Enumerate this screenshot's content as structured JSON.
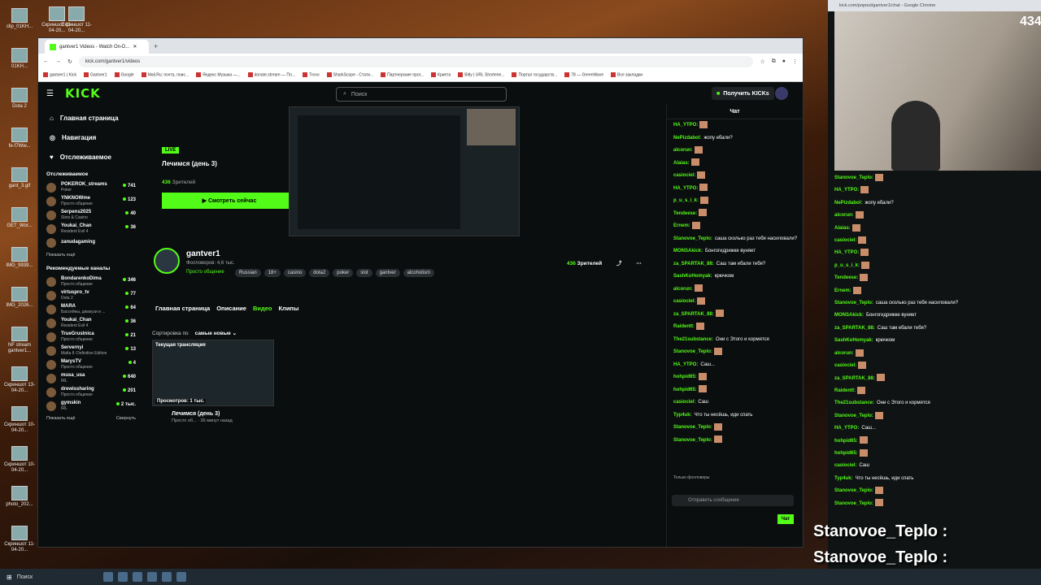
{
  "desktop": {
    "icons": [
      "clip_01KH...",
      "01KH...",
      "Dota 2",
      "fe-f7Ww...",
      "gant_3.gif",
      "GET_Wor...",
      "IMG_9939...",
      "IMG_2026...",
      "NF stream gantver1...",
      "Скриншот 13-04-20...",
      "Скриншот 10-04-20...",
      "Скриншот 10-04-20...",
      "photo_202...",
      "Скриншот 11-04-20..."
    ],
    "top_icons": [
      "Скриншот 11-04-20...",
      "Скриншот 11-04-20..."
    ]
  },
  "browser": {
    "tab_title": "gantver1 Videos - Watch On-D...",
    "url": "kick.com/gantver1/videos",
    "bookmarks": [
      "gantver1 | Kick",
      "Gantver1",
      "Google",
      "Mail.Ru: почта, поис...",
      "Яндекс Музыка —...",
      "donate.stream — Пл...",
      "Trovo",
      "SharkScope - Стати...",
      "Партнерские прог...",
      "Крипта",
      "Bitly | URL Shortene...",
      "Портал государств...",
      "78 — GreenWave",
      "Все закладки"
    ]
  },
  "kick": {
    "logo": "KICK",
    "search_placeholder": "Поиск",
    "get_kicks": "Получить KICKs",
    "nav": [
      "Главная страница",
      "Навигация",
      "Отслеживаемое"
    ],
    "followed_title": "Отслеживаемое",
    "followed": [
      {
        "name": "POKEROK_streams",
        "cat": "Poker",
        "viewers": "741"
      },
      {
        "name": "YNKNOWme",
        "cat": "Просто общение",
        "viewers": "123"
      },
      {
        "name": "Serpens2025",
        "cat": "Slots & Casino",
        "viewers": "40"
      },
      {
        "name": "Youkai_Chan",
        "cat": "Resident Evil 4",
        "viewers": "36"
      },
      {
        "name": "zanudagaming",
        "cat": "",
        "viewers": ""
      }
    ],
    "show_more": "Показать ещё",
    "recommended_title": "Рекомендуемые каналы",
    "recommended": [
      {
        "name": "BondarenkoDima",
        "cat": "Просто общение",
        "viewers": "346"
      },
      {
        "name": "virtuspro_tv",
        "cat": "Dota 2",
        "viewers": "77"
      },
      {
        "name": "MARA",
        "cat": "Бассейны, джакузи и ...",
        "viewers": "64"
      },
      {
        "name": "Youkai_Chan",
        "cat": "Resident Evil 4",
        "viewers": "36"
      },
      {
        "name": "TrueGrustnica",
        "cat": "Просто общение",
        "viewers": "21"
      },
      {
        "name": "Servernyi",
        "cat": "Mafia II: Definitive Edition",
        "viewers": "13"
      },
      {
        "name": "MarysTV",
        "cat": "Просто общение",
        "viewers": "4"
      },
      {
        "name": "musa_usa",
        "cat": "IRL",
        "viewers": "640"
      },
      {
        "name": "drewissharing",
        "cat": "Просто общение",
        "viewers": "201"
      },
      {
        "name": "gymskin",
        "cat": "IRL",
        "viewers": "2 тыс."
      }
    ],
    "show_more2": "Показать ещё",
    "collapse": "Свернуть",
    "hero": {
      "live": "LIVE",
      "title": "Лечимся (день 3)",
      "viewers": "436",
      "viewers_label": "Зрителей",
      "watch": "Смотреть сейчас"
    },
    "channel": {
      "name": "gantver1",
      "followers": "Фолловеров: 4,6 тыс.",
      "category": "Просто общение",
      "tags": [
        "Russian",
        "18+",
        "casino",
        "dota2",
        "poker",
        "slot",
        "gantver",
        "alcoholism"
      ],
      "viewers": "436",
      "viewers_label": "Зрителей"
    },
    "tabs": [
      "Главная страница",
      "Описание",
      "Видео",
      "Клипы"
    ],
    "sort_label": "Сортировка по",
    "sort_value": "самые новые",
    "video": {
      "badge": "Текущая трансляция",
      "views": "Просмотров: 1 тыс.",
      "title": "Лечимся (день 3)",
      "meta": "Просто об... · 36 минут назад"
    },
    "chat_title": "Чат",
    "chat": [
      {
        "u": "HA_YTPO:",
        "t": ""
      },
      {
        "u": "NePizdabol:",
        "t": "жопу ебали?"
      },
      {
        "u": "alcorun:",
        "t": ""
      },
      {
        "u": "Alaias:",
        "t": ""
      },
      {
        "u": "casiociel:",
        "t": ""
      },
      {
        "u": "HA_YTPO:",
        "t": ""
      },
      {
        "u": "p_u_s_i_k:",
        "t": ""
      },
      {
        "u": "Tendeese:",
        "t": ""
      },
      {
        "u": "Ernem:",
        "t": ""
      },
      {
        "u": "Stanovoe_Teplo:",
        "t": "саша сколько раз тебя насиловали?"
      },
      {
        "u": "MONSAkick:",
        "t": "Бонгогидрижке вуняет"
      },
      {
        "u": "za_SPARTAK_88:",
        "t": "Саш там ебали тебя?"
      },
      {
        "u": "SashKoHomyak:",
        "t": "крючком"
      },
      {
        "u": "alcorun:",
        "t": ""
      },
      {
        "u": "casiociel:",
        "t": ""
      },
      {
        "u": "za_SPARTAK_88:",
        "t": ""
      },
      {
        "u": "Raidentt:",
        "t": ""
      },
      {
        "u": "The21substance:",
        "t": "Они с Этого и кормятся"
      },
      {
        "u": "Stanovoe_Teplo:",
        "t": ""
      },
      {
        "u": "HA_YTPO:",
        "t": "Саш..."
      },
      {
        "u": "hohpid65:",
        "t": ""
      },
      {
        "u": "hohpid65:",
        "t": ""
      },
      {
        "u": "casiociel:",
        "t": "Саш"
      },
      {
        "u": "Typ4uk:",
        "t": "Что ты несёшь, иди спать"
      },
      {
        "u": "Stanovoe_Teplo:",
        "t": ""
      },
      {
        "u": "Stanovoe_Teplo:",
        "t": ""
      }
    ],
    "followers_only": "Только фолловеры",
    "send_placeholder": "Отправить сообщение",
    "chat_button": "Чат"
  },
  "popup": {
    "url": "kick.com/popout/gantver1/chat - Google Chrome",
    "viewers": "434",
    "cam_text": "Gantver",
    "chat": [
      {
        "u": "Stanovoe_Teplo:",
        "t": ""
      },
      {
        "u": "HA_YTPO:",
        "t": ""
      },
      {
        "u": "NePizdabol:",
        "t": "жопу ебали?"
      },
      {
        "u": "alcorun:",
        "t": ""
      },
      {
        "u": "Alaias:",
        "t": ""
      },
      {
        "u": "casiociel:",
        "t": ""
      },
      {
        "u": "HA_YTPO:",
        "t": ""
      },
      {
        "u": "p_u_s_i_k:",
        "t": ""
      },
      {
        "u": "Tendeese:",
        "t": ""
      },
      {
        "u": "Ernem:",
        "t": ""
      },
      {
        "u": "Stanovoe_Teplo:",
        "t": "саша сколько раз тебя насиловали?"
      },
      {
        "u": "MONSAkick:",
        "t": "Бонгогидрижке вуняет"
      },
      {
        "u": "za_SPARTAK_88:",
        "t": "Саш там ебали тебя?"
      },
      {
        "u": "SashKoHomyak:",
        "t": "крючком"
      },
      {
        "u": "alcorun:",
        "t": ""
      },
      {
        "u": "casiociel:",
        "t": ""
      },
      {
        "u": "za_SPARTAK_88:",
        "t": ""
      },
      {
        "u": "Raidentt:",
        "t": ""
      },
      {
        "u": "The21substance:",
        "t": "Они с Этого и кормятся"
      },
      {
        "u": "Stanovoe_Teplo:",
        "t": ""
      },
      {
        "u": "HA_YTPO:",
        "t": "Саш..."
      },
      {
        "u": "hohpid65:",
        "t": ""
      },
      {
        "u": "hohpid65:",
        "t": ""
      },
      {
        "u": "casiociel:",
        "t": "Саш"
      },
      {
        "u": "Typ4uk:",
        "t": "Что ты несёшь, иди спать"
      },
      {
        "u": "Stanovoe_Teplo:",
        "t": ""
      },
      {
        "u": "Stanovoe_Teplo:",
        "t": ""
      }
    ],
    "send_placeholder": "Отправить сообщение",
    "chat_button": "Чат",
    "overlay": [
      "Stanovoe_Teplo :",
      "Stanovoe_Teplo :"
    ]
  },
  "taskbar": {
    "search": "Поиск"
  }
}
